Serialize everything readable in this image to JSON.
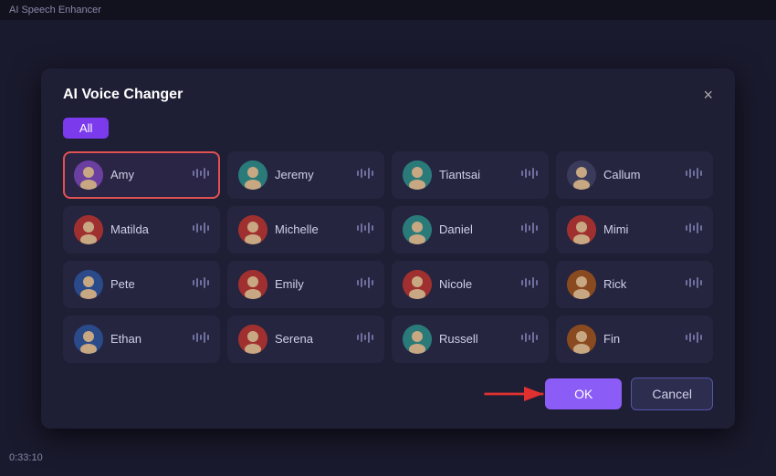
{
  "topbar": {
    "label": "AI Speech Enhancer"
  },
  "dialog": {
    "title": "AI Voice Changer",
    "close_label": "×",
    "filter": {
      "active_label": "All"
    },
    "voices": [
      {
        "id": "amy",
        "name": "Amy",
        "avatar_color": "av-purple",
        "avatar_emoji": "🙂",
        "selected": true
      },
      {
        "id": "jeremy",
        "name": "Jeremy",
        "avatar_color": "av-teal",
        "avatar_emoji": "🙂",
        "selected": false
      },
      {
        "id": "tiantsai",
        "name": "Tiantsai",
        "avatar_color": "av-teal",
        "avatar_emoji": "🙂",
        "selected": false
      },
      {
        "id": "callum",
        "name": "Callum",
        "avatar_color": "av-dark",
        "avatar_emoji": "🙂",
        "selected": false
      },
      {
        "id": "matilda",
        "name": "Matilda",
        "avatar_color": "av-red",
        "avatar_emoji": "🙂",
        "selected": false
      },
      {
        "id": "michelle",
        "name": "Michelle",
        "avatar_color": "av-red",
        "avatar_emoji": "🙂",
        "selected": false
      },
      {
        "id": "daniel",
        "name": "Daniel",
        "avatar_color": "av-teal",
        "avatar_emoji": "🙂",
        "selected": false
      },
      {
        "id": "mimi",
        "name": "Mimi",
        "avatar_color": "av-red",
        "avatar_emoji": "🙂",
        "selected": false
      },
      {
        "id": "pete",
        "name": "Pete",
        "avatar_color": "av-blue",
        "avatar_emoji": "🙂",
        "selected": false
      },
      {
        "id": "emily",
        "name": "Emily",
        "avatar_color": "av-red",
        "avatar_emoji": "🙂",
        "selected": false
      },
      {
        "id": "nicole",
        "name": "Nicole",
        "avatar_color": "av-red",
        "avatar_emoji": "🙂",
        "selected": false
      },
      {
        "id": "rick",
        "name": "Rick",
        "avatar_color": "av-orange",
        "avatar_emoji": "🙂",
        "selected": false
      },
      {
        "id": "ethan",
        "name": "Ethan",
        "avatar_color": "av-blue",
        "avatar_emoji": "🙂",
        "selected": false
      },
      {
        "id": "serena",
        "name": "Serena",
        "avatar_color": "av-red",
        "avatar_emoji": "🙂",
        "selected": false
      },
      {
        "id": "russell",
        "name": "Russell",
        "avatar_color": "av-teal",
        "avatar_emoji": "🙂",
        "selected": false
      },
      {
        "id": "fin",
        "name": "Fin",
        "avatar_color": "av-orange",
        "avatar_emoji": "🙂",
        "selected": false
      }
    ],
    "wave_symbol": "|||",
    "ok_label": "OK",
    "cancel_label": "Cancel"
  },
  "timer": "0:33:10"
}
